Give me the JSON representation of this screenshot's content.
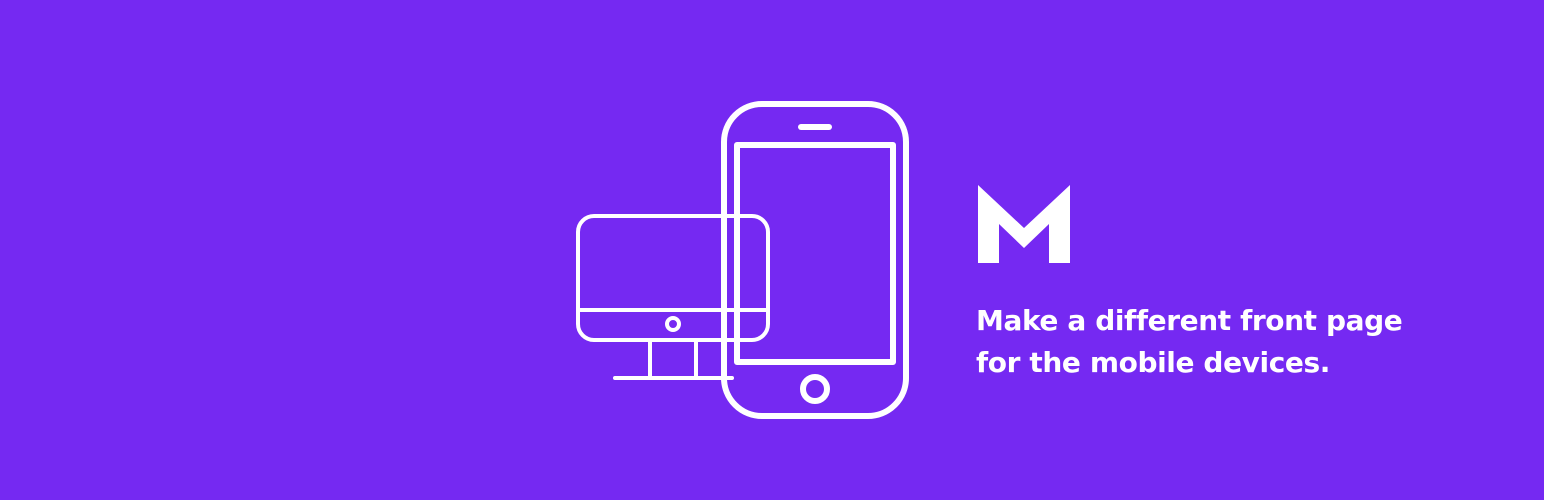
{
  "brand": {
    "logo_letter": "M",
    "background_color": "#7529f2",
    "foreground_color": "#ffffff"
  },
  "tagline": {
    "line1": "Make a different front page",
    "line2": "for the mobile devices."
  },
  "icons": {
    "devices": "desktop-and-smartphone-icon",
    "logo": "m-logo-icon"
  }
}
